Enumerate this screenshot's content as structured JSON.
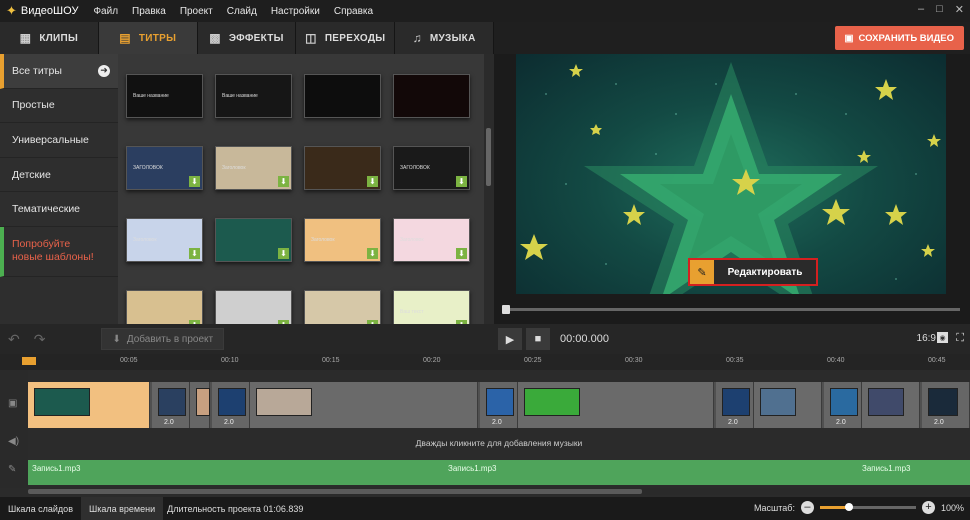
{
  "app": {
    "name": "ВидеоШОУ"
  },
  "menu": [
    "Файл",
    "Правка",
    "Проект",
    "Слайд",
    "Настройки",
    "Справка"
  ],
  "window_controls": [
    "–",
    "□",
    "✕"
  ],
  "tabs": [
    {
      "label": "КЛИПЫ",
      "icon": "film-icon"
    },
    {
      "label": "ТИТРЫ",
      "icon": "titles-icon",
      "active": true
    },
    {
      "label": "ЭФФЕКТЫ",
      "icon": "effects-icon"
    },
    {
      "label": "ПЕРЕХОДЫ",
      "icon": "transitions-icon"
    },
    {
      "label": "МУЗЫКА",
      "icon": "music-icon"
    }
  ],
  "save_button": "СОХРАНИТЬ ВИДЕО",
  "categories": [
    {
      "label": "Все титры",
      "active": true
    },
    {
      "label": "Простые"
    },
    {
      "label": "Универсальные"
    },
    {
      "label": "Детские"
    },
    {
      "label": "Тематические"
    }
  ],
  "promo": {
    "line1": "Попробуйте",
    "line2": "новые шаблоны!"
  },
  "thumbnails": [
    {
      "caption": "Ваше название",
      "bg": "#111111",
      "download": false
    },
    {
      "caption": "Ваше название",
      "bg": "#161616",
      "download": false
    },
    {
      "caption": "",
      "bg": "#0d0d0d",
      "download": false
    },
    {
      "caption": "",
      "bg": "#120808",
      "download": false
    },
    {
      "caption": "ЗАГОЛОВОК",
      "bg": "#2b3e60",
      "download": true
    },
    {
      "caption": "Заголовок",
      "bg": "#c8b89a",
      "download": true
    },
    {
      "caption": "",
      "bg": "#3a2a1a",
      "download": true
    },
    {
      "caption": "ЗАГОЛОВОК",
      "bg": "#1a1a1a",
      "download": true
    },
    {
      "caption": "Заголовок",
      "bg": "#c8d4ea",
      "download": true
    },
    {
      "caption": "",
      "bg": "#1c5a4e",
      "download": true
    },
    {
      "caption": "Заголовок",
      "bg": "#f0c080",
      "download": true
    },
    {
      "caption": "Заголовок",
      "bg": "#f4d8e0",
      "download": true
    },
    {
      "caption": "",
      "bg": "#d8c090",
      "download": true
    },
    {
      "caption": "",
      "bg": "#cfcfcf",
      "download": true
    },
    {
      "caption": "",
      "bg": "#d6c8a8",
      "download": true
    },
    {
      "caption": "Ваш текст",
      "bg": "#e8f0c8",
      "download": true
    }
  ],
  "edit_button": "Редактировать",
  "toolbar": {
    "add_to_project": "Добавить в проект"
  },
  "player": {
    "time": "00:00.000",
    "aspect_ratio": "16:9"
  },
  "ruler": [
    "00:05",
    "00:10",
    "00:15",
    "00:20",
    "00:25",
    "00:30",
    "00:35",
    "00:40",
    "00:45"
  ],
  "transition_durations": [
    "2.0",
    "2.0",
    "2.0",
    "2.0",
    "2.0",
    "2.0",
    "2.0",
    "2.0"
  ],
  "music_hint": "Дважды кликните для добавления музыки",
  "records": [
    "Запись1.mp3",
    "Запись1.mp3",
    "Запись1.mp3"
  ],
  "status": {
    "tab_slides": "Шкала слайдов",
    "tab_timeline": "Шкала времени",
    "duration": "Длительность проекта 01:06.839",
    "zoom_label": "Масштаб:",
    "zoom_value": "100%"
  }
}
